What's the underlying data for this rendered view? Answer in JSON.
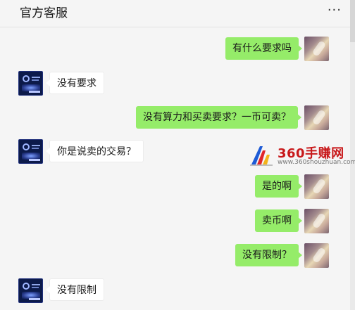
{
  "header": {
    "title": "官方客服",
    "more_label": "···"
  },
  "messages": [
    {
      "sender": "self",
      "text": "有什么要求吗"
    },
    {
      "sender": "other",
      "text": "没有要求"
    },
    {
      "sender": "self",
      "text": "没有算力和买卖要求？一币可卖？"
    },
    {
      "sender": "other",
      "text": "你是说卖的交易？"
    },
    {
      "sender": "self",
      "text": "是的啊"
    },
    {
      "sender": "self",
      "text": "卖币啊"
    },
    {
      "sender": "self",
      "text": "没有限制？"
    },
    {
      "sender": "other",
      "text": "没有限制"
    }
  ],
  "watermark": {
    "brand": "360手赚网",
    "url": "www.360shouzhuan.com"
  },
  "colors": {
    "self_bubble": "#95ec69",
    "other_bubble": "#ffffff",
    "background": "#f5f5f5",
    "watermark_brand": "#c8191b"
  }
}
